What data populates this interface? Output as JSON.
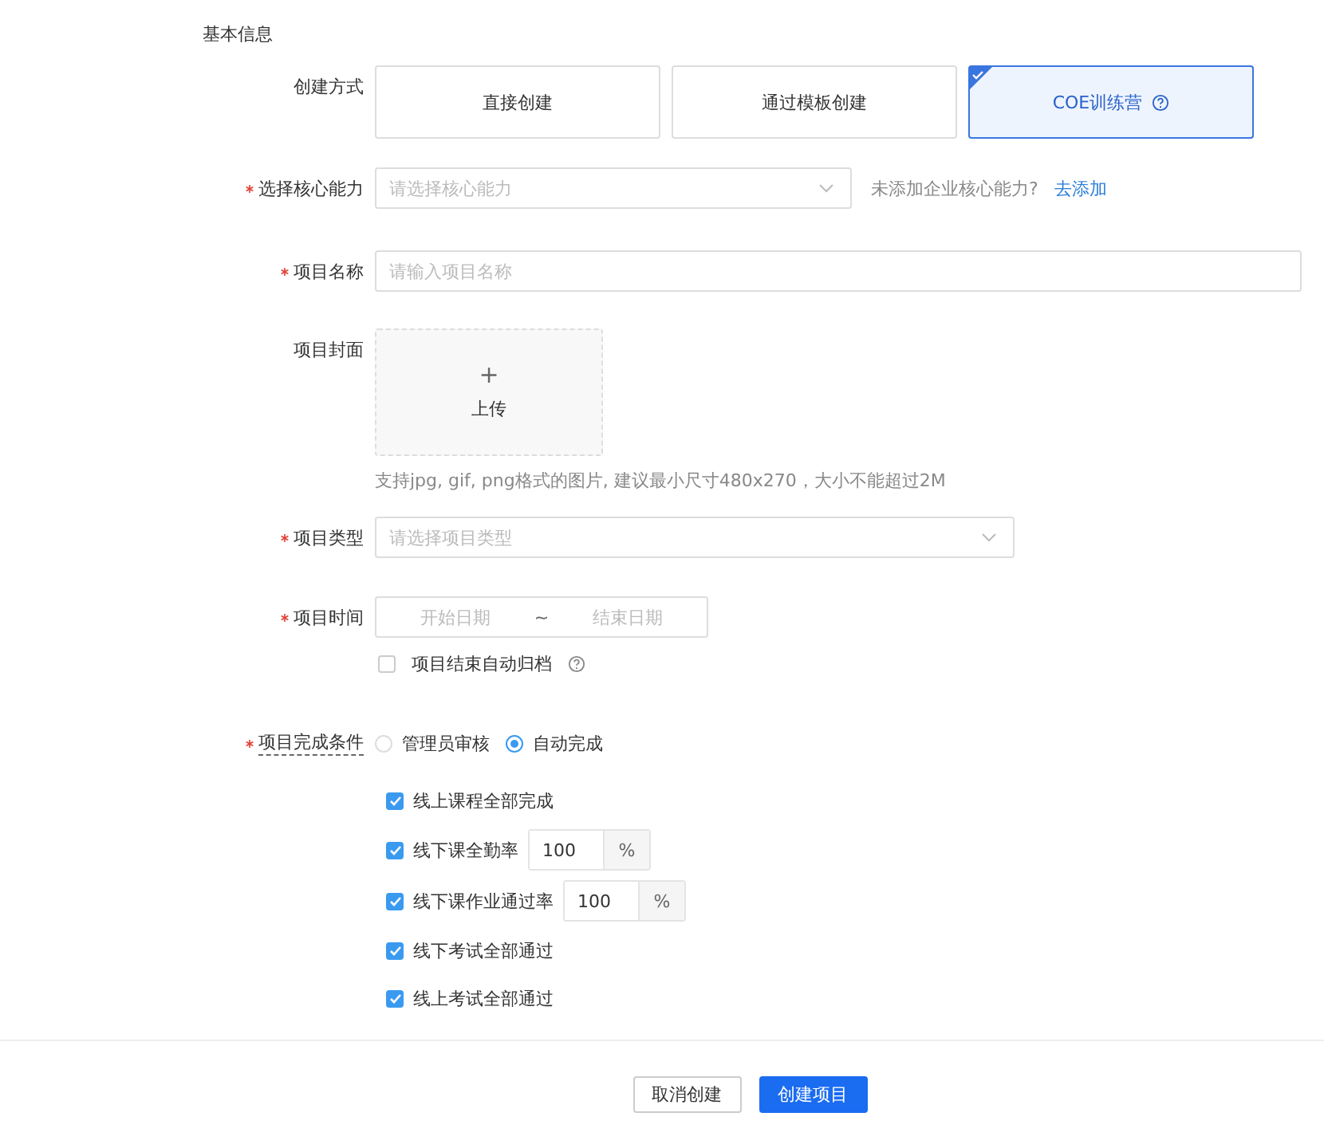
{
  "section_title": "基本信息",
  "creation_method": {
    "label": "创建方式",
    "required": false,
    "options": [
      {
        "label": "直接创建",
        "selected": false,
        "help": false
      },
      {
        "label": "通过模板创建",
        "selected": false,
        "help": false
      },
      {
        "label": "COE训练营",
        "selected": true,
        "help": true
      }
    ]
  },
  "core_ability": {
    "label": "选择核心能力",
    "required": true,
    "placeholder": "请选择核心能力",
    "hint": "未添加企业核心能力?",
    "link": "去添加"
  },
  "project_name": {
    "label": "项目名称",
    "required": true,
    "placeholder": "请输入项目名称"
  },
  "cover": {
    "label": "项目封面",
    "required": false,
    "plus": "+",
    "upload": "上传",
    "hint": "支持jpg, gif, png格式的图片, 建议最小尺寸480x270，大小不能超过2M"
  },
  "project_type": {
    "label": "项目类型",
    "required": true,
    "placeholder": "请选择项目类型"
  },
  "project_time": {
    "label": "项目时间",
    "required": true,
    "start_placeholder": "开始日期",
    "separator": "~",
    "end_placeholder": "结束日期",
    "auto_archive": {
      "label": "项目结束自动归档",
      "checked": false
    }
  },
  "completion": {
    "label": "项目完成条件",
    "required": true,
    "modes": [
      {
        "label": "管理员审核",
        "selected": false
      },
      {
        "label": "自动完成",
        "selected": true
      }
    ],
    "conditions": [
      {
        "kind": "check",
        "label": "线上课程全部完成",
        "checked": true
      },
      {
        "kind": "percent",
        "label": "线下课全勤率",
        "checked": true,
        "value": "100",
        "unit": "%"
      },
      {
        "kind": "percent",
        "label": "线下课作业通过率",
        "checked": true,
        "value": "100",
        "unit": "%"
      },
      {
        "kind": "check",
        "label": "线下考试全部通过",
        "checked": true
      },
      {
        "kind": "check",
        "label": "线上考试全部通过",
        "checked": true
      }
    ]
  },
  "footer": {
    "cancel": "取消创建",
    "submit": "创建项目"
  }
}
